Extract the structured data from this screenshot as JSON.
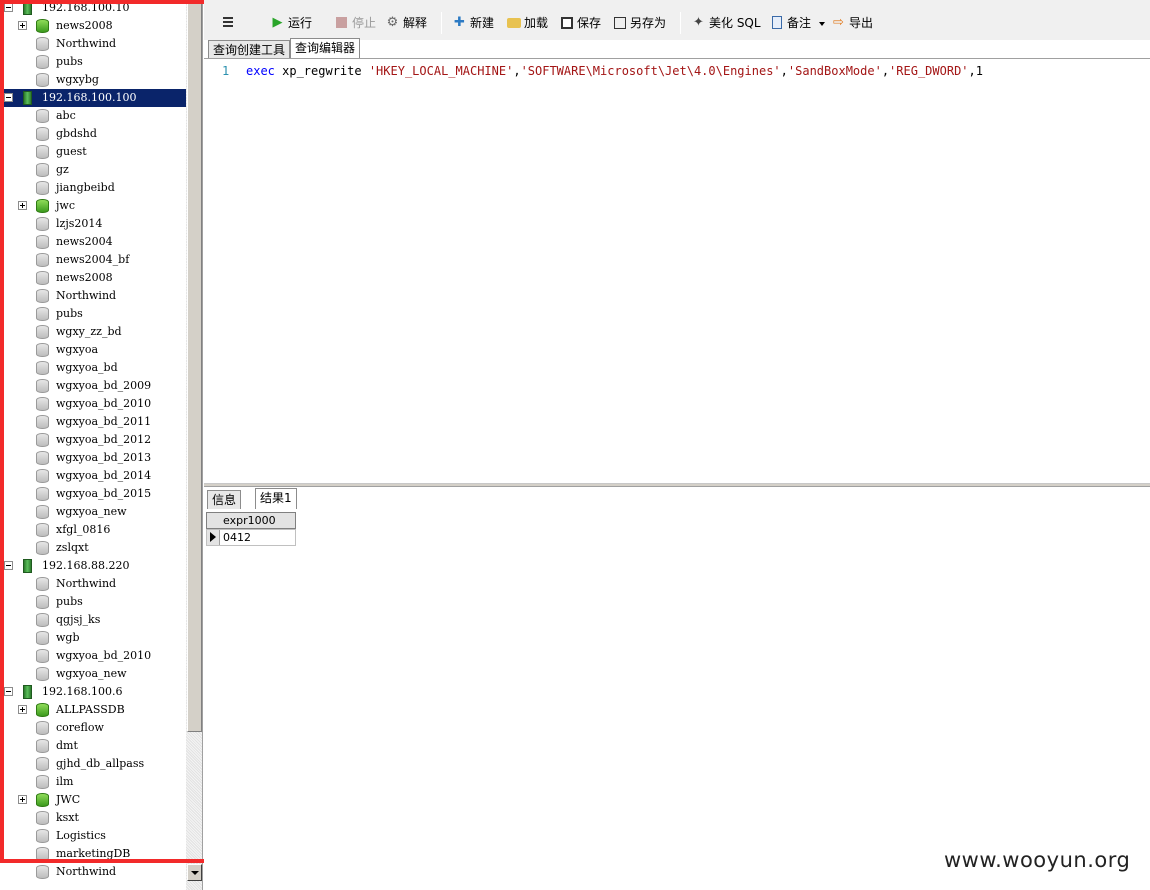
{
  "tree": {
    "items": [
      {
        "label": "192.168.100.10",
        "type": "server",
        "expander": "minus"
      },
      {
        "label": "news2008",
        "type": "db-green",
        "expander": "plus"
      },
      {
        "label": "Northwind",
        "type": "db"
      },
      {
        "label": "pubs",
        "type": "db"
      },
      {
        "label": "wgxybg",
        "type": "db"
      },
      {
        "label": "192.168.100.100",
        "type": "server",
        "expander": "minus",
        "selected": true
      },
      {
        "label": "abc",
        "type": "db"
      },
      {
        "label": "gbdshd",
        "type": "db"
      },
      {
        "label": "guest",
        "type": "db"
      },
      {
        "label": "gz",
        "type": "db"
      },
      {
        "label": "jiangbeibd",
        "type": "db"
      },
      {
        "label": "jwc",
        "type": "db-green",
        "expander": "plus"
      },
      {
        "label": "lzjs2014",
        "type": "db"
      },
      {
        "label": "news2004",
        "type": "db"
      },
      {
        "label": "news2004_bf",
        "type": "db"
      },
      {
        "label": "news2008",
        "type": "db"
      },
      {
        "label": "Northwind",
        "type": "db"
      },
      {
        "label": "pubs",
        "type": "db"
      },
      {
        "label": "wgxy_zz_bd",
        "type": "db"
      },
      {
        "label": "wgxyoa",
        "type": "db"
      },
      {
        "label": "wgxyoa_bd",
        "type": "db"
      },
      {
        "label": "wgxyoa_bd_2009",
        "type": "db"
      },
      {
        "label": "wgxyoa_bd_2010",
        "type": "db"
      },
      {
        "label": "wgxyoa_bd_2011",
        "type": "db"
      },
      {
        "label": "wgxyoa_bd_2012",
        "type": "db"
      },
      {
        "label": "wgxyoa_bd_2013",
        "type": "db"
      },
      {
        "label": "wgxyoa_bd_2014",
        "type": "db"
      },
      {
        "label": "wgxyoa_bd_2015",
        "type": "db"
      },
      {
        "label": "wgxyoa_new",
        "type": "db"
      },
      {
        "label": "xfgl_0816",
        "type": "db"
      },
      {
        "label": "zslqxt",
        "type": "db"
      },
      {
        "label": "192.168.88.220",
        "type": "server",
        "expander": "minus"
      },
      {
        "label": "Northwind",
        "type": "db"
      },
      {
        "label": "pubs",
        "type": "db"
      },
      {
        "label": "qgjsj_ks",
        "type": "db"
      },
      {
        "label": "wgb",
        "type": "db"
      },
      {
        "label": "wgxyoa_bd_2010",
        "type": "db"
      },
      {
        "label": "wgxyoa_new",
        "type": "db"
      },
      {
        "label": "192.168.100.6",
        "type": "server",
        "expander": "minus"
      },
      {
        "label": "ALLPASSDB",
        "type": "db-green",
        "expander": "plus"
      },
      {
        "label": "coreflow",
        "type": "db"
      },
      {
        "label": "dmt",
        "type": "db"
      },
      {
        "label": "gjhd_db_allpass",
        "type": "db"
      },
      {
        "label": "ilm",
        "type": "db"
      },
      {
        "label": "JWC",
        "type": "db-green",
        "expander": "plus"
      },
      {
        "label": "ksxt",
        "type": "db"
      },
      {
        "label": "Logistics",
        "type": "db"
      },
      {
        "label": "marketingDB",
        "type": "db"
      },
      {
        "label": "Northwind",
        "type": "db"
      }
    ]
  },
  "toolbar": {
    "run": "运行",
    "stop": "停止",
    "explain": "解释",
    "new": "新建",
    "load": "加载",
    "save": "保存",
    "save_as": "另存为",
    "beautify": "美化 SQL",
    "note": "备注",
    "export": "导出"
  },
  "editor_tabs": {
    "builder": "查询创建工具",
    "editor": "查询编辑器"
  },
  "editor": {
    "line_number": "1",
    "kw_exec": "exec",
    "proc": " xp_regwrite ",
    "arg1": "'HKEY_LOCAL_MACHINE'",
    "arg2": "'SOFTWARE\\Microsoft\\Jet\\4.0\\Engines'",
    "arg3": "'SandBoxMode'",
    "arg4": "'REG_DWORD'",
    "arg5": "1",
    "comma": ","
  },
  "result_tabs": {
    "info": "信息",
    "result1": "结果1"
  },
  "result_grid": {
    "column": "expr1000",
    "value": "0412"
  },
  "watermark": "www.wooyun.org"
}
